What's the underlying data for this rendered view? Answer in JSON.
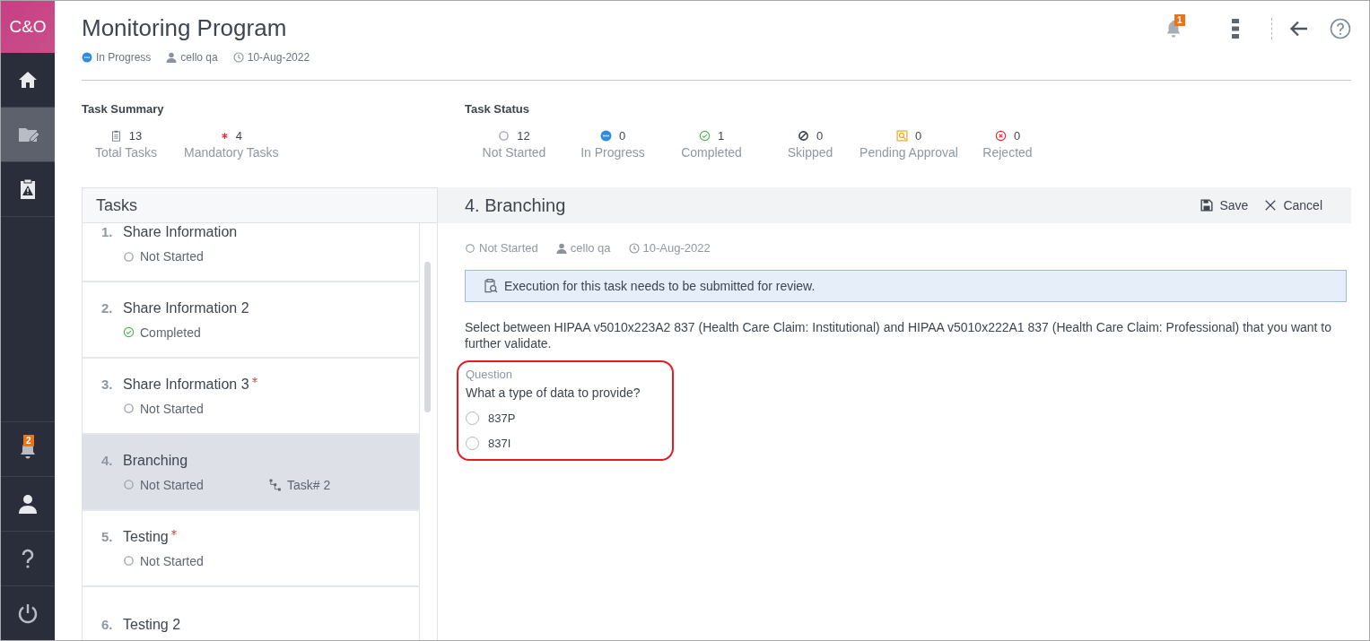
{
  "sidebar": {
    "logo": "C&O",
    "items": [
      {
        "selected": false
      },
      {
        "selected": true
      },
      {
        "selected": false
      },
      {
        "selected": false,
        "badge": "2"
      },
      {
        "selected": false
      },
      {
        "selected": false
      },
      {
        "selected": false
      }
    ]
  },
  "header": {
    "title": "Monitoring Program",
    "status": {
      "kind": "in_progress",
      "label": "In Progress"
    },
    "user": "cello qa",
    "date": "10-Aug-2022",
    "notification_badge": "1"
  },
  "task_summary": {
    "title": "Task Summary",
    "stats": [
      {
        "kind": "total",
        "count": "13",
        "label": "Total Tasks"
      },
      {
        "kind": "mandatory",
        "count": "4",
        "label": "Mandatory Tasks"
      }
    ]
  },
  "task_status": {
    "title": "Task Status",
    "stats": [
      {
        "kind": "not_started",
        "count": "12",
        "label": "Not Started"
      },
      {
        "kind": "in_progress",
        "count": "0",
        "label": "In Progress"
      },
      {
        "kind": "completed",
        "count": "1",
        "label": "Completed"
      },
      {
        "kind": "skipped",
        "count": "0",
        "label": "Skipped"
      },
      {
        "kind": "pending_approval",
        "count": "0",
        "label": "Pending Approval"
      },
      {
        "kind": "rejected",
        "count": "0",
        "label": "Rejected"
      }
    ]
  },
  "tasks": {
    "title": "Tasks",
    "items": [
      {
        "number": "1.",
        "name": "Share Information",
        "mandatory": false,
        "status": {
          "kind": "not_started",
          "label": "Not Started"
        },
        "selected": false
      },
      {
        "number": "2.",
        "name": "Share Information 2",
        "mandatory": false,
        "status": {
          "kind": "completed",
          "label": "Completed"
        },
        "selected": false
      },
      {
        "number": "3.",
        "name": "Share Information 3",
        "mandatory": true,
        "status": {
          "kind": "not_started",
          "label": "Not Started"
        },
        "selected": false
      },
      {
        "number": "4.",
        "name": "Branching",
        "mandatory": false,
        "status": {
          "kind": "not_started",
          "label": "Not Started"
        },
        "branch": "Task# 2",
        "selected": true
      },
      {
        "number": "5.",
        "name": "Testing",
        "mandatory": true,
        "status": {
          "kind": "not_started",
          "label": "Not Started"
        },
        "selected": false
      },
      {
        "number": "6.",
        "name": "Testing 2",
        "mandatory": false,
        "selected": false
      }
    ]
  },
  "detail": {
    "title": "4. Branching",
    "actions": [
      {
        "kind": "save",
        "label": "Save"
      },
      {
        "kind": "cancel",
        "label": "Cancel"
      }
    ],
    "status": {
      "kind": "not_started",
      "label": "Not Started"
    },
    "user": "cello qa",
    "date": "10-Aug-2022",
    "notice": "Execution for this task needs to be submitted for review.",
    "description": "Select between HIPAA v5010x223A2 837 (Health Care Claim: Institutional) and HIPAA v5010x222A1 837 (Health Care Claim: Professional) that you want to further validate.",
    "question": {
      "caption": "Question",
      "text": "What a type of data to provide?",
      "options": [
        {
          "label": "837P",
          "selected": false
        },
        {
          "label": "837I",
          "selected": false
        }
      ]
    }
  }
}
